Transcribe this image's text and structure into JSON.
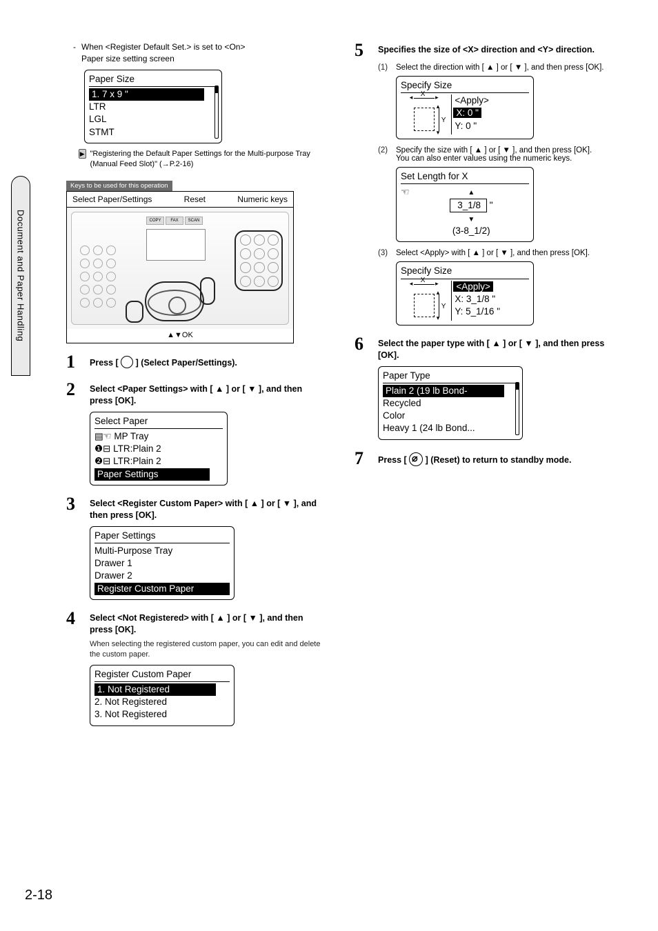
{
  "sideTab": "Document and Paper Handling",
  "pageNumber": "2-18",
  "left": {
    "bullet": {
      "line1": "When <Register Default Set.> is set to <On>",
      "line2": "Paper size setting screen"
    },
    "lcd_paperSize": {
      "title": "Paper Size",
      "hl": "1.  7 x 9 \"",
      "r1": "LTR",
      "r2": "LGL",
      "r3": "STMT"
    },
    "xref": "\"Registering the Default Paper Settings for the Multi-purpose Tray (Manual Feed Slot)\" (→P.2-16)",
    "keysBand": "Keys to be used for this operation",
    "panelLabels": {
      "a": "Select Paper/Settings",
      "b": "Reset",
      "c": "Numeric keys"
    },
    "panelTabs": {
      "a": "COPY",
      "b": "FAX",
      "c": "SCAN"
    },
    "panelCaption": "▲▼OK",
    "step1": "Press [     ] (Select Paper/Settings).",
    "step2": "Select <Paper Settings> with [ ▲ ] or [ ▼ ], and then press [OK].",
    "lcd_selectPaper": {
      "title": "Select Paper",
      "r1": "MP Tray",
      "r2": "LTR:Plain 2",
      "r3": "LTR:Plain 2",
      "hl": "Paper Settings"
    },
    "step3": "Select <Register Custom Paper> with [ ▲ ] or [ ▼ ], and then press [OK].",
    "lcd_paperSettings": {
      "title": "Paper Settings",
      "r1": "Multi-Purpose Tray",
      "r2": "Drawer 1",
      "r3": "Drawer 2",
      "hl": "Register Custom Paper"
    },
    "step4": "Select <Not Registered> with [ ▲ ] or [ ▼ ], and then press [OK].",
    "step4note": "When selecting the registered custom paper, you can edit and delete the custom paper.",
    "lcd_register": {
      "title": "Register Custom Paper",
      "hl": "1. Not Registered",
      "r2": "2. Not Registered",
      "r3": "3. Not Registered"
    }
  },
  "right": {
    "step5": "Specifies the size of <X> direction and <Y> direction.",
    "s5_1": "Select the direction with [ ▲ ] or [ ▼ ], and then press [OK].",
    "lcd_specify1": {
      "title": "Specify Size",
      "apply": "<Apply>",
      "xl": "X: 0 \"",
      "yl": "Y: 0 \""
    },
    "s5_2a": "Specify the size with [ ▲ ] or [ ▼ ], and then press [OK].",
    "s5_2b": "You can also enter values using the numeric keys.",
    "lcd_setlen": {
      "title": "Set Length for X",
      "val": "3_1/8",
      "unit": "\"",
      "range": "(3-8_1/2)"
    },
    "s5_3": "Select <Apply> with [ ▲ ] or [ ▼ ], and then press [OK].",
    "lcd_specify2": {
      "title": "Specify Size",
      "apply": "<Apply>",
      "xl": "X: 3_1/8 \"",
      "yl": "Y: 5_1/16 \""
    },
    "step6": "Select the paper type with [ ▲ ] or [ ▼ ], and then press [OK].",
    "lcd_paperType": {
      "title": "Paper Type",
      "hl": "Plain 2 (19 lb Bond-",
      "r1": "Recycled",
      "r2": "Color",
      "r3": "Heavy 1 (24 lb Bond..."
    },
    "step7": "Press [     ] (Reset) to return to standby mode."
  }
}
